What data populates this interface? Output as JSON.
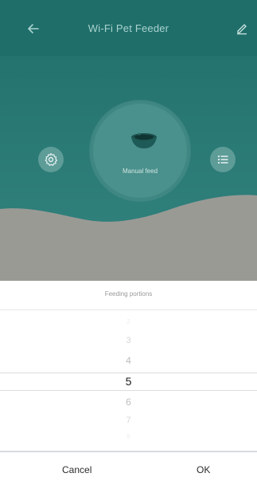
{
  "header": {
    "title": "Wi-Fi Pet Feeder",
    "back_icon": "arrow-left-icon",
    "edit_icon": "pencil-icon"
  },
  "hero": {
    "manual_feed_label": "Manual feed",
    "bowl_icon": "pet-bowl-icon",
    "settings_icon": "gear-icon",
    "list_icon": "list-icon"
  },
  "sheet": {
    "title": "Feeding portions",
    "picker": {
      "items": [
        "2",
        "3",
        "4",
        "5",
        "6",
        "7",
        "8"
      ],
      "selected": "5"
    },
    "cancel_label": "Cancel",
    "ok_label": "OK"
  },
  "colors": {
    "teal_dark": "#1f6e6a",
    "teal": "#2e7d79",
    "hero_bottom": "#9a9a95"
  }
}
